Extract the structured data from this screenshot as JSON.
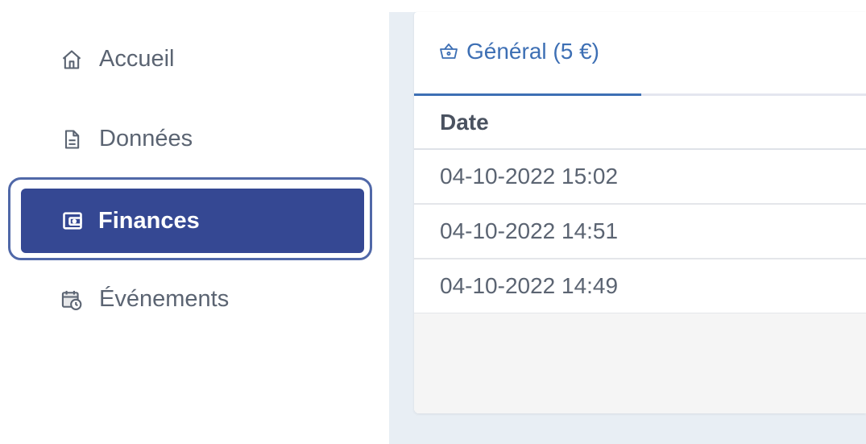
{
  "sidebar": {
    "items": [
      {
        "label": "Accueil",
        "icon": "home-icon"
      },
      {
        "label": "Données",
        "icon": "document-icon"
      },
      {
        "label": "Finances",
        "icon": "wallet-icon",
        "active": true
      },
      {
        "label": "Événements",
        "icon": "calendar-clock-icon"
      }
    ]
  },
  "main": {
    "tabs": [
      {
        "label": "Général (5 €)",
        "icon": "basket-icon",
        "active": true
      }
    ],
    "table": {
      "columns": [
        "Date"
      ],
      "rows": [
        [
          "04-10-2022 15:02"
        ],
        [
          "04-10-2022 14:51"
        ],
        [
          "04-10-2022 14:49"
        ]
      ]
    }
  },
  "colors": {
    "accent": "#354893",
    "tab_active": "#3d6fb4",
    "text_muted": "#5b6472"
  }
}
